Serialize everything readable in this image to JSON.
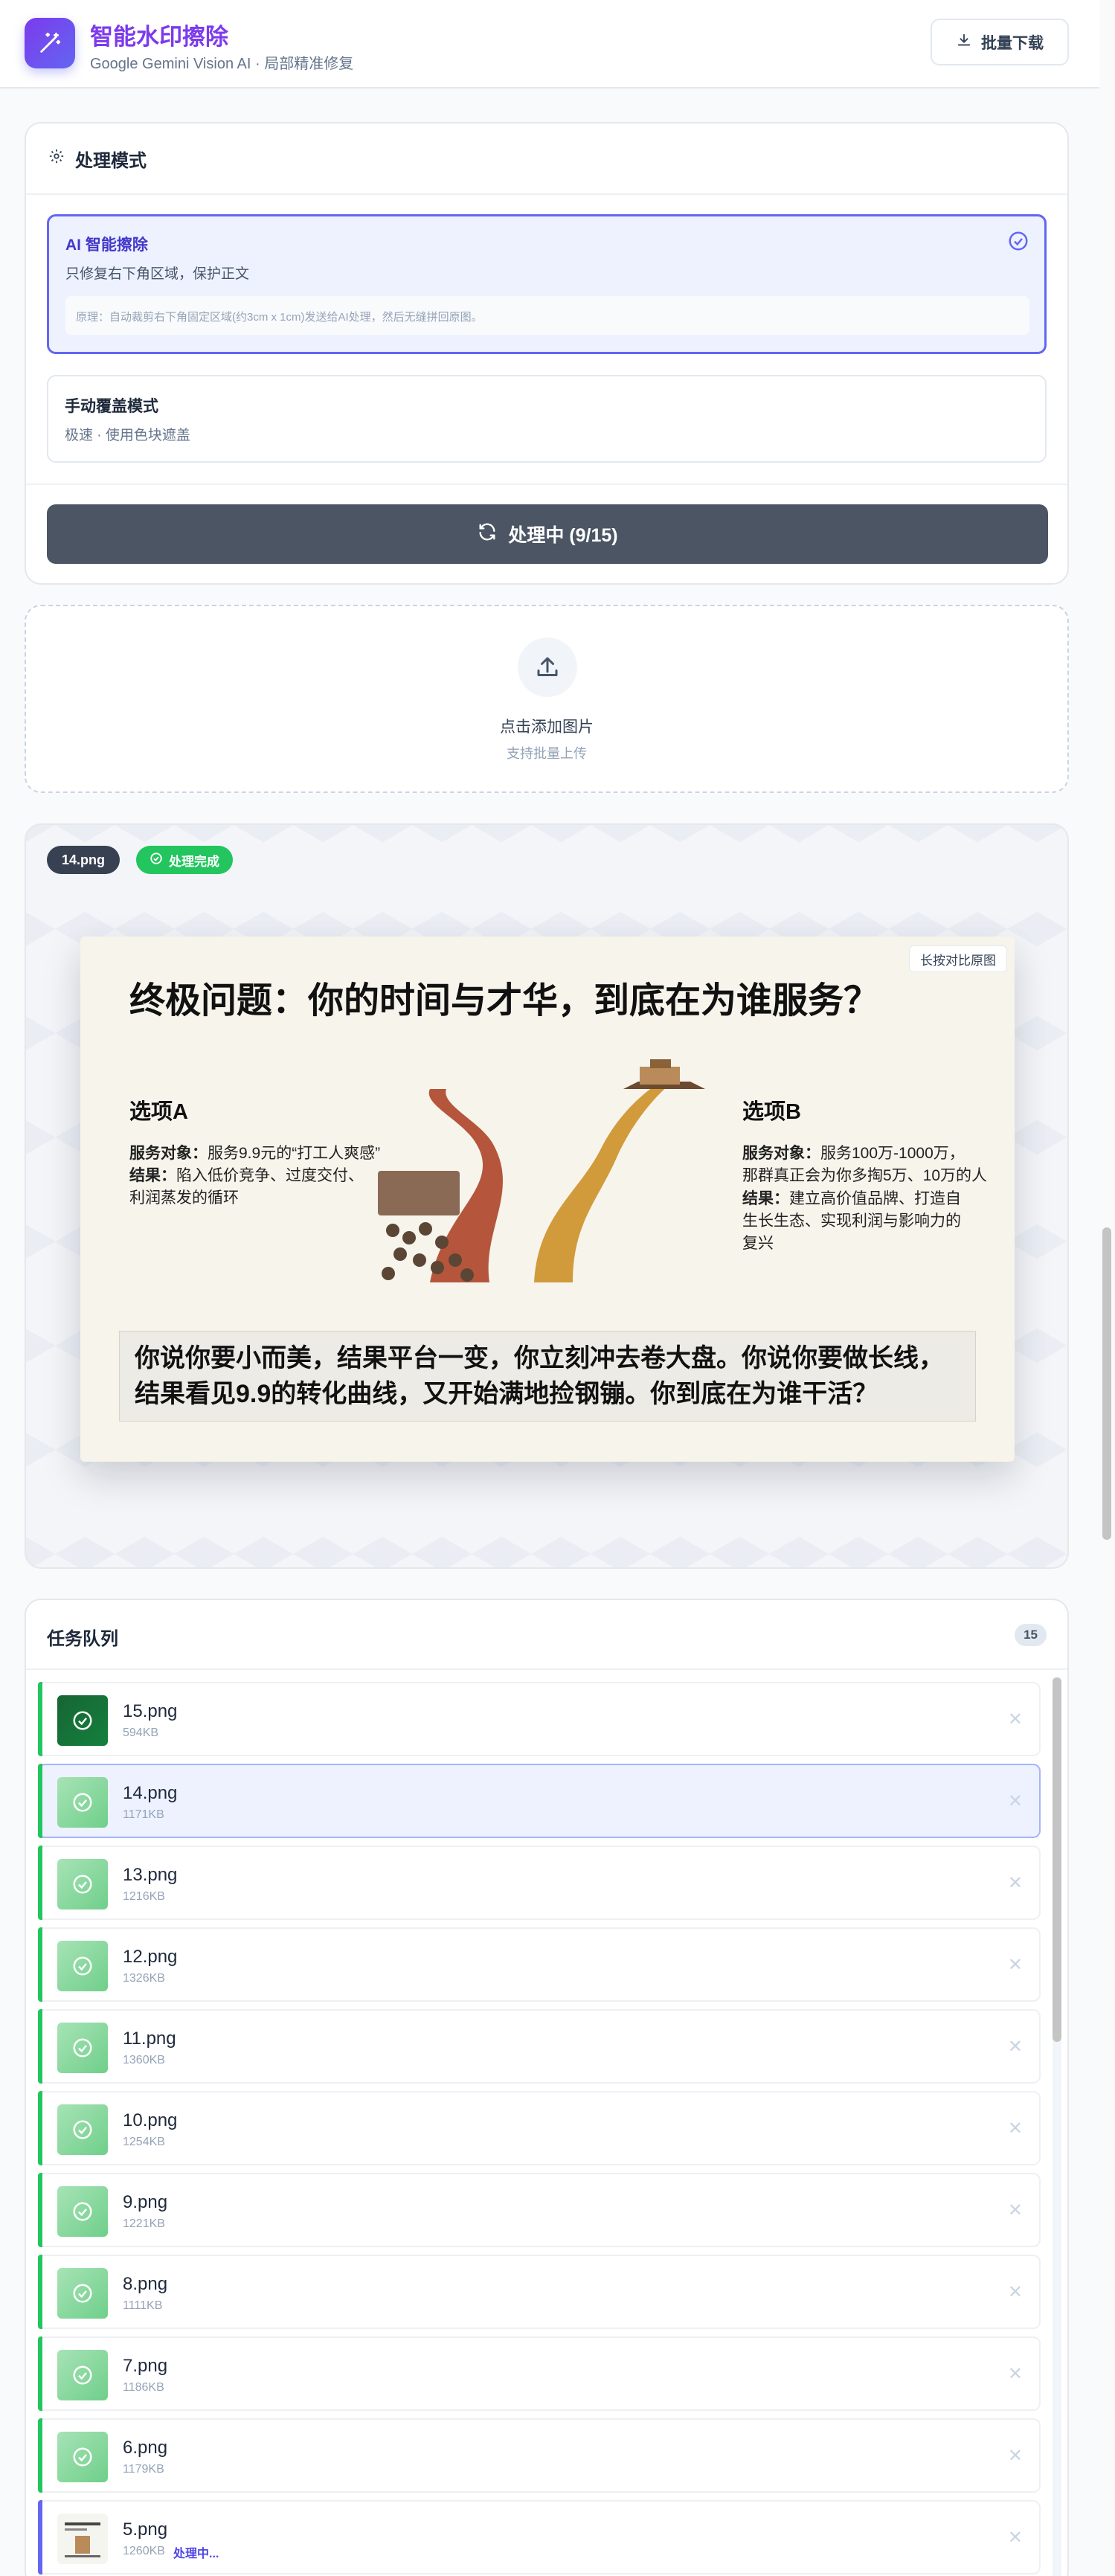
{
  "header": {
    "title": "智能水印擦除",
    "subtitle": "Google Gemini Vision AI · 局部精准修复",
    "download_label": "批量下载"
  },
  "mode": {
    "heading": "处理模式",
    "ai_title": "AI 智能擦除",
    "ai_desc": "只修复右下角区域，保护正文",
    "ai_note": "原理：自动裁剪右下角固定区域(约3cm x 1cm)发送给AI处理，然后无缝拼回原图。",
    "manual_title": "手动覆盖模式",
    "manual_desc": "极速 · 使用色块遮盖",
    "process_label": "处理中 (9/15)"
  },
  "upload": {
    "title": "点击添加图片",
    "desc": "支持批量上传"
  },
  "preview": {
    "filename": "14.png",
    "status": "处理完成",
    "compare_label": "长按对比原图",
    "slide": {
      "title": "终极问题：你的时间与才华，到底在为谁服务？",
      "optionA_title": "选项A",
      "optionA_k1": "服务对象：",
      "optionA_v1": "服务9.9元的“打工人爽感”",
      "optionA_k2": "结果：",
      "optionA_v2": "陷入低价竞争、过度交付、",
      "optionA_v3": "利润蒸发的循环",
      "optionB_title": "选项B",
      "optionB_k1": "服务对象：",
      "optionB_v1": "服务100万-1000万，",
      "optionB_v2": "那群真正会为你多掏5万、10万的人",
      "optionB_k2": "结果：",
      "optionB_v3": "建立高价值品牌、打造自",
      "optionB_v4": "生长生态、实现利润与影响力的",
      "optionB_v5": "复兴",
      "quote_line1": "你说你要小而美，结果平台一变，你立刻冲去卷大盘。你说你要做长线，",
      "quote_line2": "结果看见9.9的转化曲线，又开始满地捡钢镚。你到底在为谁干活？"
    }
  },
  "queue": {
    "heading": "任务队列",
    "count": "15",
    "items": [
      {
        "name": "15.png",
        "size": "594KB",
        "status": ""
      },
      {
        "name": "14.png",
        "size": "1171KB",
        "status": ""
      },
      {
        "name": "13.png",
        "size": "1216KB",
        "status": ""
      },
      {
        "name": "12.png",
        "size": "1326KB",
        "status": ""
      },
      {
        "name": "11.png",
        "size": "1360KB",
        "status": ""
      },
      {
        "name": "10.png",
        "size": "1254KB",
        "status": ""
      },
      {
        "name": "9.png",
        "size": "1221KB",
        "status": ""
      },
      {
        "name": "8.png",
        "size": "1111KB",
        "status": ""
      },
      {
        "name": "7.png",
        "size": "1186KB",
        "status": ""
      },
      {
        "name": "6.png",
        "size": "1179KB",
        "status": ""
      },
      {
        "name": "5.png",
        "size": "1260KB",
        "status": "处理中..."
      }
    ]
  },
  "icons": {
    "logo": "magic-wand-icon",
    "download": "download-icon",
    "settings": "gear-icon",
    "check": "check-circle-icon",
    "refresh": "refresh-icon",
    "upload": "upload-icon",
    "remove": "close-icon"
  },
  "colors": {
    "brand": "#7c3aed",
    "accent": "#6366f1",
    "success": "#22c55e",
    "processing_button": "#4b5563"
  }
}
